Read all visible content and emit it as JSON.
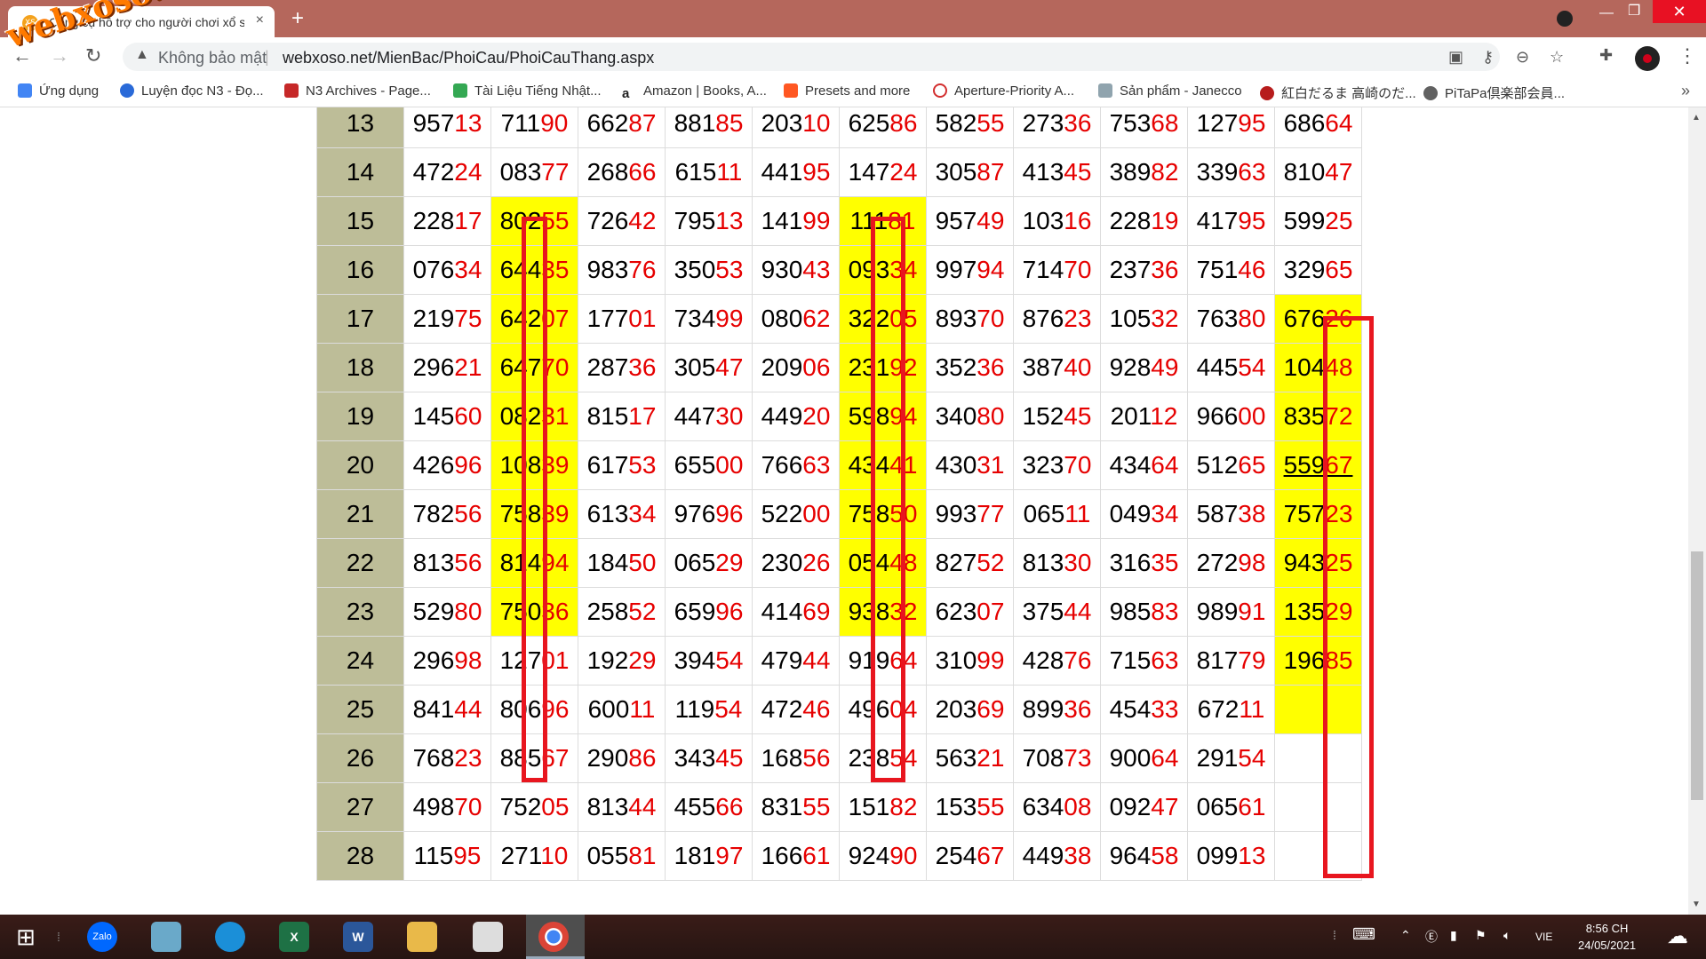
{
  "tab": {
    "favicon": "XS",
    "title": "Công cụ hỗ trợ cho người chơi xổ số",
    "close": "×"
  },
  "window": {
    "newtab": "+",
    "minimize": "—",
    "maximize": "❐",
    "close": "✕"
  },
  "omnibox": {
    "security": "Không bảo mật",
    "separator": "|",
    "url": "webxoso.net/MienBac/PhoiCau/PhoiCauThang.aspx"
  },
  "bookmarks": [
    {
      "label": "Ứng dụng",
      "color": "#4285f4"
    },
    {
      "label": "Luyện đọc N3 - Đọ...",
      "color": "#2a6ad8"
    },
    {
      "label": "N3 Archives - Page...",
      "color": "#c62828"
    },
    {
      "label": "Tài Liệu Tiếng Nhật...",
      "color": "#34a853"
    },
    {
      "label": "Amazon | Books, A...",
      "color": "#222222"
    },
    {
      "label": "Presets and more",
      "color": "#ff5722"
    },
    {
      "label": "Aperture-Priority A...",
      "color": "#d32f2f"
    },
    {
      "label": "Sản phẩm - Janecco",
      "color": "#90a4ae"
    },
    {
      "label": "紅白だるま 高崎のだ...",
      "color": "#b71c1c"
    },
    {
      "label": "PiTaPa倶楽部会員...",
      "color": "#616161"
    }
  ],
  "bookmarks_more": "»",
  "watermark": "webxoso.net",
  "grid": {
    "rows": [
      {
        "day": "13",
        "cells": [
          [
            "957",
            "13"
          ],
          [
            "711",
            "90"
          ],
          [
            "662",
            "87"
          ],
          [
            "881",
            "85"
          ],
          [
            "203",
            "10"
          ],
          [
            "625",
            "86"
          ],
          [
            "582",
            "55"
          ],
          [
            "273",
            "36"
          ],
          [
            "753",
            "68"
          ],
          [
            "127",
            "95"
          ],
          [
            "686",
            "64"
          ]
        ]
      },
      {
        "day": "14",
        "cells": [
          [
            "472",
            "24"
          ],
          [
            "083",
            "77"
          ],
          [
            "268",
            "66"
          ],
          [
            "615",
            "11"
          ],
          [
            "441",
            "95"
          ],
          [
            "147",
            "24"
          ],
          [
            "305",
            "87"
          ],
          [
            "413",
            "45"
          ],
          [
            "389",
            "82"
          ],
          [
            "339",
            "63"
          ],
          [
            "810",
            "47"
          ]
        ]
      },
      {
        "day": "15",
        "cells": [
          [
            "228",
            "17"
          ],
          [
            "802",
            "55"
          ],
          [
            "726",
            "42"
          ],
          [
            "795",
            "13"
          ],
          [
            "141",
            "99"
          ],
          [
            "111",
            "81"
          ],
          [
            "957",
            "49"
          ],
          [
            "103",
            "16"
          ],
          [
            "228",
            "19"
          ],
          [
            "417",
            "95"
          ],
          [
            "599",
            "25"
          ]
        ]
      },
      {
        "day": "16",
        "cells": [
          [
            "076",
            "34"
          ],
          [
            "644",
            "35"
          ],
          [
            "983",
            "76"
          ],
          [
            "350",
            "53"
          ],
          [
            "930",
            "43"
          ],
          [
            "093",
            "34"
          ],
          [
            "997",
            "94"
          ],
          [
            "714",
            "70"
          ],
          [
            "237",
            "36"
          ],
          [
            "751",
            "46"
          ],
          [
            "329",
            "65"
          ]
        ]
      },
      {
        "day": "17",
        "cells": [
          [
            "219",
            "75"
          ],
          [
            "642",
            "07"
          ],
          [
            "177",
            "01"
          ],
          [
            "734",
            "99"
          ],
          [
            "080",
            "62"
          ],
          [
            "322",
            "05"
          ],
          [
            "893",
            "70"
          ],
          [
            "876",
            "23"
          ],
          [
            "105",
            "32"
          ],
          [
            "763",
            "80"
          ],
          [
            "676",
            "26"
          ]
        ]
      },
      {
        "day": "18",
        "cells": [
          [
            "296",
            "21"
          ],
          [
            "647",
            "70"
          ],
          [
            "287",
            "36"
          ],
          [
            "305",
            "47"
          ],
          [
            "209",
            "06"
          ],
          [
            "231",
            "92"
          ],
          [
            "352",
            "36"
          ],
          [
            "387",
            "40"
          ],
          [
            "928",
            "49"
          ],
          [
            "445",
            "54"
          ],
          [
            "104",
            "48"
          ]
        ]
      },
      {
        "day": "19",
        "cells": [
          [
            "145",
            "60"
          ],
          [
            "082",
            "31"
          ],
          [
            "815",
            "17"
          ],
          [
            "447",
            "30"
          ],
          [
            "449",
            "20"
          ],
          [
            "598",
            "94"
          ],
          [
            "340",
            "80"
          ],
          [
            "152",
            "45"
          ],
          [
            "201",
            "12"
          ],
          [
            "966",
            "00"
          ],
          [
            "835",
            "72"
          ]
        ]
      },
      {
        "day": "20",
        "cells": [
          [
            "426",
            "96"
          ],
          [
            "108",
            "39"
          ],
          [
            "617",
            "53"
          ],
          [
            "655",
            "00"
          ],
          [
            "766",
            "63"
          ],
          [
            "434",
            "41"
          ],
          [
            "430",
            "31"
          ],
          [
            "323",
            "70"
          ],
          [
            "434",
            "64"
          ],
          [
            "512",
            "65"
          ],
          [
            "559",
            "67"
          ]
        ]
      },
      {
        "day": "21",
        "cells": [
          [
            "782",
            "56"
          ],
          [
            "758",
            "39"
          ],
          [
            "613",
            "34"
          ],
          [
            "976",
            "96"
          ],
          [
            "522",
            "00"
          ],
          [
            "758",
            "50"
          ],
          [
            "993",
            "77"
          ],
          [
            "065",
            "11"
          ],
          [
            "049",
            "34"
          ],
          [
            "587",
            "38"
          ],
          [
            "757",
            "23"
          ]
        ]
      },
      {
        "day": "22",
        "cells": [
          [
            "813",
            "56"
          ],
          [
            "814",
            "94"
          ],
          [
            "184",
            "50"
          ],
          [
            "065",
            "29"
          ],
          [
            "230",
            "26"
          ],
          [
            "054",
            "48"
          ],
          [
            "827",
            "52"
          ],
          [
            "813",
            "30"
          ],
          [
            "316",
            "35"
          ],
          [
            "272",
            "98"
          ],
          [
            "943",
            "25"
          ]
        ]
      },
      {
        "day": "23",
        "cells": [
          [
            "529",
            "80"
          ],
          [
            "750",
            "36"
          ],
          [
            "258",
            "52"
          ],
          [
            "659",
            "96"
          ],
          [
            "414",
            "69"
          ],
          [
            "938",
            "32"
          ],
          [
            "623",
            "07"
          ],
          [
            "375",
            "44"
          ],
          [
            "985",
            "83"
          ],
          [
            "989",
            "91"
          ],
          [
            "135",
            "29"
          ]
        ]
      },
      {
        "day": "24",
        "cells": [
          [
            "296",
            "98"
          ],
          [
            "127",
            "01"
          ],
          [
            "192",
            "29"
          ],
          [
            "394",
            "54"
          ],
          [
            "479",
            "44"
          ],
          [
            "919",
            "64"
          ],
          [
            "310",
            "99"
          ],
          [
            "428",
            "76"
          ],
          [
            "715",
            "63"
          ],
          [
            "817",
            "79"
          ],
          [
            "196",
            "85"
          ]
        ]
      },
      {
        "day": "25",
        "cells": [
          [
            "841",
            "44"
          ],
          [
            "806",
            "96"
          ],
          [
            "600",
            "11"
          ],
          [
            "119",
            "54"
          ],
          [
            "472",
            "46"
          ],
          [
            "496",
            "04"
          ],
          [
            "203",
            "69"
          ],
          [
            "899",
            "36"
          ],
          [
            "454",
            "33"
          ],
          [
            "672",
            "11"
          ],
          [
            "",
            ""
          ]
        ]
      },
      {
        "day": "26",
        "cells": [
          [
            "768",
            "23"
          ],
          [
            "885",
            "67"
          ],
          [
            "290",
            "86"
          ],
          [
            "343",
            "45"
          ],
          [
            "168",
            "56"
          ],
          [
            "238",
            "54"
          ],
          [
            "563",
            "21"
          ],
          [
            "708",
            "73"
          ],
          [
            "900",
            "64"
          ],
          [
            "291",
            "54"
          ],
          [
            "",
            ""
          ]
        ]
      },
      {
        "day": "27",
        "cells": [
          [
            "498",
            "70"
          ],
          [
            "752",
            "05"
          ],
          [
            "813",
            "44"
          ],
          [
            "455",
            "66"
          ],
          [
            "831",
            "55"
          ],
          [
            "151",
            "82"
          ],
          [
            "153",
            "55"
          ],
          [
            "634",
            "08"
          ],
          [
            "092",
            "47"
          ],
          [
            "065",
            "61"
          ],
          [
            "",
            ""
          ]
        ]
      },
      {
        "day": "28",
        "cells": [
          [
            "115",
            "95"
          ],
          [
            "271",
            "10"
          ],
          [
            "055",
            "81"
          ],
          [
            "181",
            "97"
          ],
          [
            "166",
            "61"
          ],
          [
            "924",
            "90"
          ],
          [
            "254",
            "67"
          ],
          [
            "449",
            "38"
          ],
          [
            "964",
            "58"
          ],
          [
            "099",
            "13"
          ],
          [
            "",
            ""
          ]
        ]
      }
    ]
  },
  "colors": {
    "highlight": "#ffff00",
    "red_digits": "#e60000",
    "day_col": "#bdbd98",
    "box": "#e8161f"
  },
  "taskbar": {
    "apps": [
      {
        "name": "zalo-icon",
        "label": "Zalo"
      },
      {
        "name": "notes-icon",
        "label": ""
      },
      {
        "name": "edge-icon",
        "label": ""
      },
      {
        "name": "excel-icon",
        "label": "X"
      },
      {
        "name": "word-icon",
        "label": "W"
      },
      {
        "name": "folder-icon",
        "label": ""
      },
      {
        "name": "app-icon",
        "label": ""
      },
      {
        "name": "chrome-icon",
        "label": ""
      }
    ],
    "lang": "VIE",
    "time": "8:56 CH",
    "date": "24/05/2021"
  }
}
